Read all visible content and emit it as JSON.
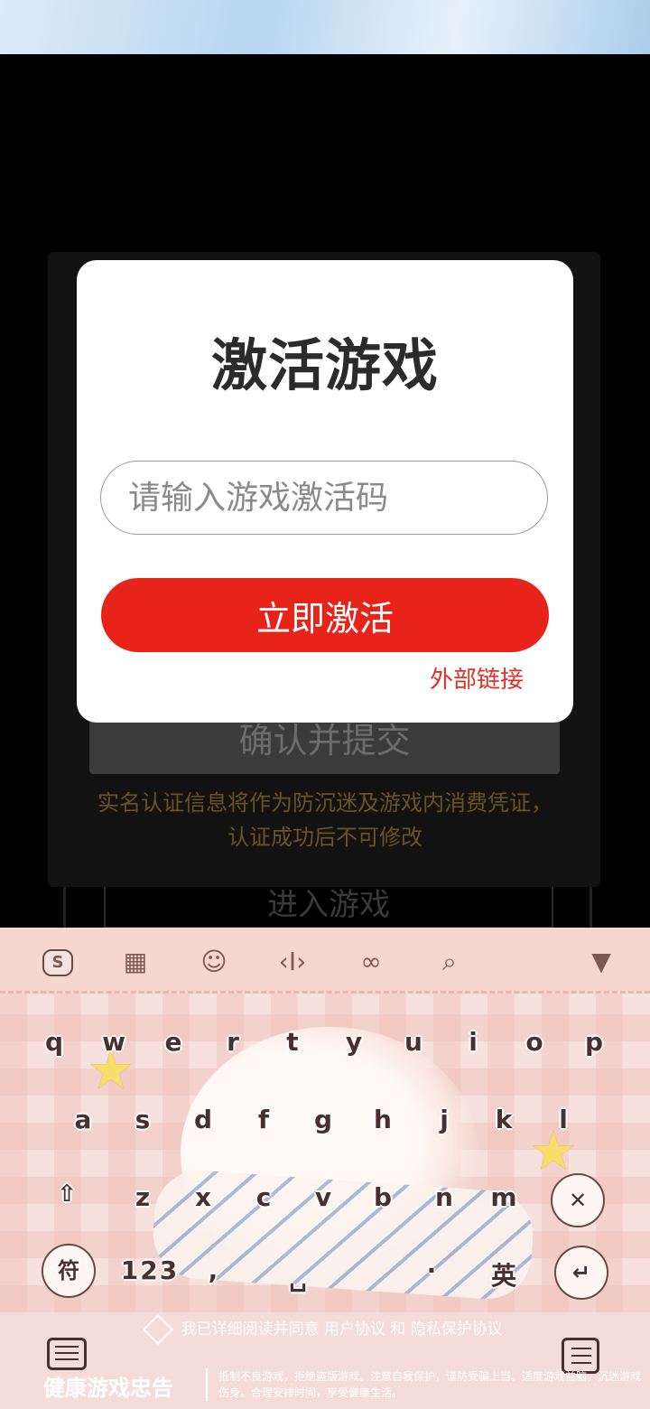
{
  "background_page": {
    "submit_label": "确认并提交",
    "notice": "实名认证信息将作为防沉迷及游戏内消费凭证，认证成功后不可修改",
    "enter_label": "进入游戏"
  },
  "dialog": {
    "title": "激活游戏",
    "input_placeholder": "请输入游戏激活码",
    "input_value": "",
    "activate_label": "立即激活",
    "external_link": "外部链接"
  },
  "keyboard": {
    "toolbar": {
      "skin_label": "S",
      "icons": [
        "skin-icon",
        "keyboard-layout-icon",
        "emoji-icon",
        "cursor-icon",
        "link-icon",
        "search-icon",
        "collapse-icon"
      ]
    },
    "row1": [
      "q",
      "w",
      "e",
      "r",
      "t",
      "y",
      "u",
      "i",
      "o",
      "p"
    ],
    "row2": [
      "a",
      "s",
      "d",
      "f",
      "g",
      "h",
      "j",
      "k",
      "l"
    ],
    "row3": [
      "z",
      "x",
      "c",
      "v",
      "b",
      "n",
      "m"
    ],
    "shift_label": "⇧",
    "delete_label": "✕",
    "symbols_label": "符",
    "numbers_label": "123",
    "comma_label": ",",
    "period_label": "·",
    "lang_label": "英",
    "enter_label": "↵"
  },
  "bottom": {
    "agree_prefix": "我已详细阅读并同意",
    "user_agreement": "用户协议",
    "and": "和",
    "privacy_agreement": "隐私保护协议",
    "health_title": "健康游戏忠告",
    "health_text": "抵制不良游戏，拒绝盗版游戏。注意自我保护，谨防受骗上当。适度游戏益脑，沉迷游戏伤身。合理安排时间，享受健康生活。"
  }
}
